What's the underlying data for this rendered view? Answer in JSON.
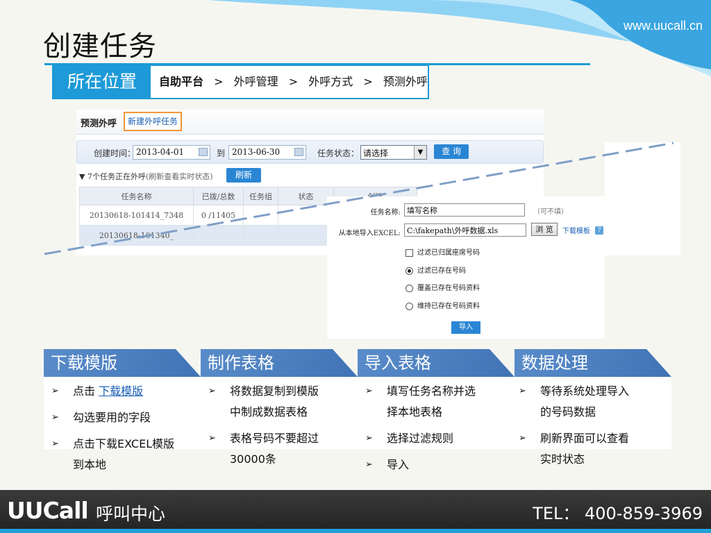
{
  "header": {
    "url": "www.uucall.cn",
    "title": "创建任务"
  },
  "location": {
    "label": "所在位置",
    "crumbs": [
      "自助平台",
      "外呼管理",
      "外呼方式",
      "预测外呼"
    ],
    "separator": ">"
  },
  "screenshot1": {
    "title": "预测外呼",
    "new_task": "新建外呼任务",
    "created_label": "创建时间：",
    "date_from": "2013-04-01",
    "to_label": "到",
    "date_to": "2013-06-30",
    "status_label": "任务状态：",
    "status_value": "请选择",
    "query": "查 询",
    "running_count_text": "7个任务正在外呼",
    "running_hint": "(刷新查看实时状态)",
    "refresh": "刷新",
    "columns": [
      "任务名称",
      "已拨/总数",
      "任务组",
      "状态",
      "创建"
    ],
    "rows": [
      [
        "20130618-101414_7348",
        "0 /11405",
        "",
        "",
        ""
      ],
      [
        "20130618-101340_",
        "",
        "",
        "",
        ""
      ]
    ]
  },
  "screenshot2": {
    "name_label": "任务名称:",
    "name_value": "填写名称",
    "name_hint": "（可不填）",
    "import_label": "从本地导入EXCEL:",
    "import_value": "C:\\fakepath\\外呼数据.xls",
    "browse": "浏 览",
    "download_template": "下载模板",
    "help": "?",
    "options": [
      {
        "label": "过滤已归属座席号码",
        "type": "checkbox",
        "checked": false
      },
      {
        "label": "过滤已存在号码",
        "type": "radio",
        "checked": true
      },
      {
        "label": "覆盖已存在号码资料",
        "type": "radio",
        "checked": false
      },
      {
        "label": "维持已存在号码资料",
        "type": "radio",
        "checked": false
      }
    ],
    "import_button": "导入"
  },
  "steps": [
    {
      "title": "下载模版",
      "bullets": [
        [
          "点击 ",
          "下载模版"
        ],
        [
          "勾选要用的字段"
        ],
        [
          "点击下载EXCEL模版",
          "到本地"
        ]
      ]
    },
    {
      "title": "制作表格",
      "bullets": [
        [
          "将数据复制到模版",
          "中制成数据表格"
        ],
        [
          "表格号码不要超过",
          "30000条"
        ]
      ]
    },
    {
      "title": "导入表格",
      "bullets": [
        [
          "填写任务名称并选",
          "择本地表格"
        ],
        [
          "选择过滤规则"
        ],
        [
          "导入"
        ]
      ]
    },
    {
      "title": "数据处理",
      "bullets": [
        [
          "等待系统处理导入",
          "的号码数据"
        ],
        [
          "刷新界面可以查看",
          "实时状态"
        ]
      ]
    }
  ],
  "step_colors": [
    "#4a7fc1",
    "#4a7fc1",
    "#4a7fc1",
    "#4a7fc1"
  ],
  "footer": {
    "logo": "UUCall",
    "logo_sub": "呼叫中心",
    "tel": "TEL：  400-859-3969"
  },
  "icons": {
    "bullet": "arrow-bullet-icon",
    "calendar": "calendar-icon",
    "dropdown": "chevron-down-icon",
    "expand": "triangle-down-icon"
  }
}
